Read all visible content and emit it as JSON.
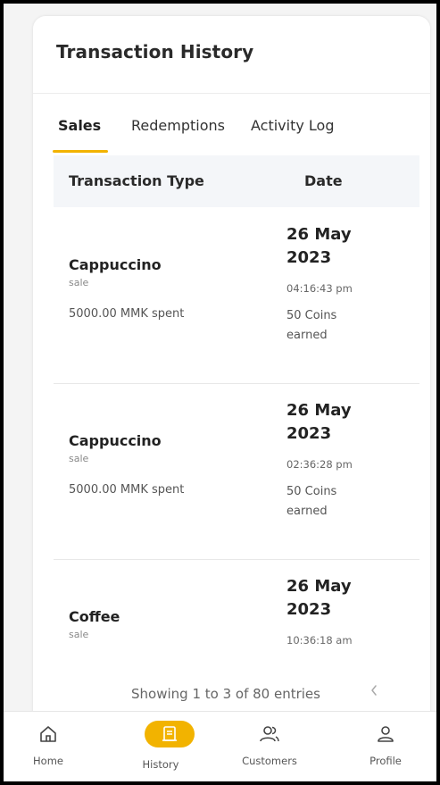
{
  "card": {
    "title": "Transaction History"
  },
  "tabs": [
    {
      "label": "Sales",
      "active": true
    },
    {
      "label": "Redemptions",
      "active": false
    },
    {
      "label": "Activity Log",
      "active": false
    }
  ],
  "table": {
    "headers": {
      "type": "Transaction Type",
      "date": "Date"
    },
    "rows": [
      {
        "name": "Cappuccino",
        "type": "sale",
        "spent": "5000.00 MMK spent",
        "date_day": "26 May",
        "date_year": "2023",
        "time": "04:16:43 pm",
        "earned_line1": "50 Coins",
        "earned_line2": "earned"
      },
      {
        "name": "Cappuccino",
        "type": "sale",
        "spent": "5000.00 MMK spent",
        "date_day": "26 May",
        "date_year": "2023",
        "time": "02:36:28 pm",
        "earned_line1": "50 Coins",
        "earned_line2": "earned"
      },
      {
        "name": "Coffee",
        "type": "sale",
        "spent": "",
        "date_day": "26 May",
        "date_year": "2023",
        "time": "10:36:18 am",
        "earned_line1": "",
        "earned_line2": ""
      }
    ]
  },
  "pagination": {
    "summary": "Showing 1 to 3 of 80 entries",
    "prev_icon": "chevron-left-icon"
  },
  "nav": [
    {
      "label": "Home",
      "icon": "home-icon"
    },
    {
      "label": "History",
      "icon": "receipt-icon",
      "active": true
    },
    {
      "label": "Customers",
      "icon": "users-icon"
    },
    {
      "label": "Profile",
      "icon": "user-icon"
    }
  ],
  "colors": {
    "accent": "#f2b300",
    "background": "#f4f4f4",
    "card": "#ffffff",
    "table_header": "#f4f6f9"
  }
}
